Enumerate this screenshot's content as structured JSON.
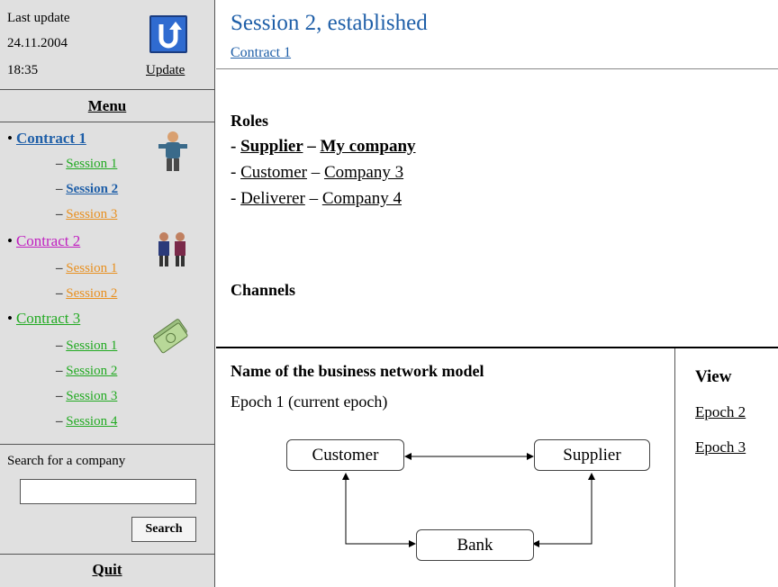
{
  "sidebar": {
    "last_update_label": "Last update",
    "date": "24.11.2004",
    "time": "18:35",
    "update_label": "Update",
    "menu_title": "Menu",
    "contracts": [
      {
        "label": "Contract 1",
        "color": "#1f5fa8",
        "bold": true,
        "sessions": [
          {
            "label": "Session 1",
            "color": "#22aa22",
            "bold": false
          },
          {
            "label": "Session 2",
            "color": "#1f5fa8",
            "bold": true
          },
          {
            "label": "Session 3",
            "color": "#e89020",
            "bold": false
          }
        ]
      },
      {
        "label": "Contract 2",
        "color": "#c020c0",
        "bold": false,
        "sessions": [
          {
            "label": "Session 1",
            "color": "#e89020",
            "bold": false
          },
          {
            "label": "Session 2",
            "color": "#e89020",
            "bold": false
          }
        ]
      },
      {
        "label": "Contract 3",
        "color": "#22aa22",
        "bold": false,
        "sessions": [
          {
            "label": "Session 1",
            "color": "#22aa22",
            "bold": false
          },
          {
            "label": "Session 2",
            "color": "#22aa22",
            "bold": false
          },
          {
            "label": "Session 3",
            "color": "#22aa22",
            "bold": false
          },
          {
            "label": "Session 4",
            "color": "#22aa22",
            "bold": false
          }
        ]
      }
    ],
    "search_label": "Search for a company",
    "search_value": "",
    "search_button": "Search",
    "quit_label": "Quit"
  },
  "main": {
    "title": "Session 2, established",
    "subtitle": "Contract 1",
    "roles_heading": "Roles",
    "roles": [
      {
        "role": "Supplier",
        "company": "My company",
        "bold": true
      },
      {
        "role": "Customer",
        "company": "Company 3",
        "bold": false
      },
      {
        "role": "Deliverer",
        "company": "Company 4",
        "bold": false
      }
    ],
    "channels_heading": "Channels",
    "network_heading": "Name of the business network model",
    "current_epoch": "Epoch 1 (current epoch)",
    "view_heading": "View",
    "epochs": [
      "Epoch 2",
      "Epoch 3"
    ],
    "diagram_nodes": [
      "Customer",
      "Supplier",
      "Bank"
    ]
  },
  "icons": {
    "update": "update-arrow-icon",
    "contract1": "worker-icon",
    "contract2": "people-group-icon",
    "contract3": "money-icon"
  }
}
